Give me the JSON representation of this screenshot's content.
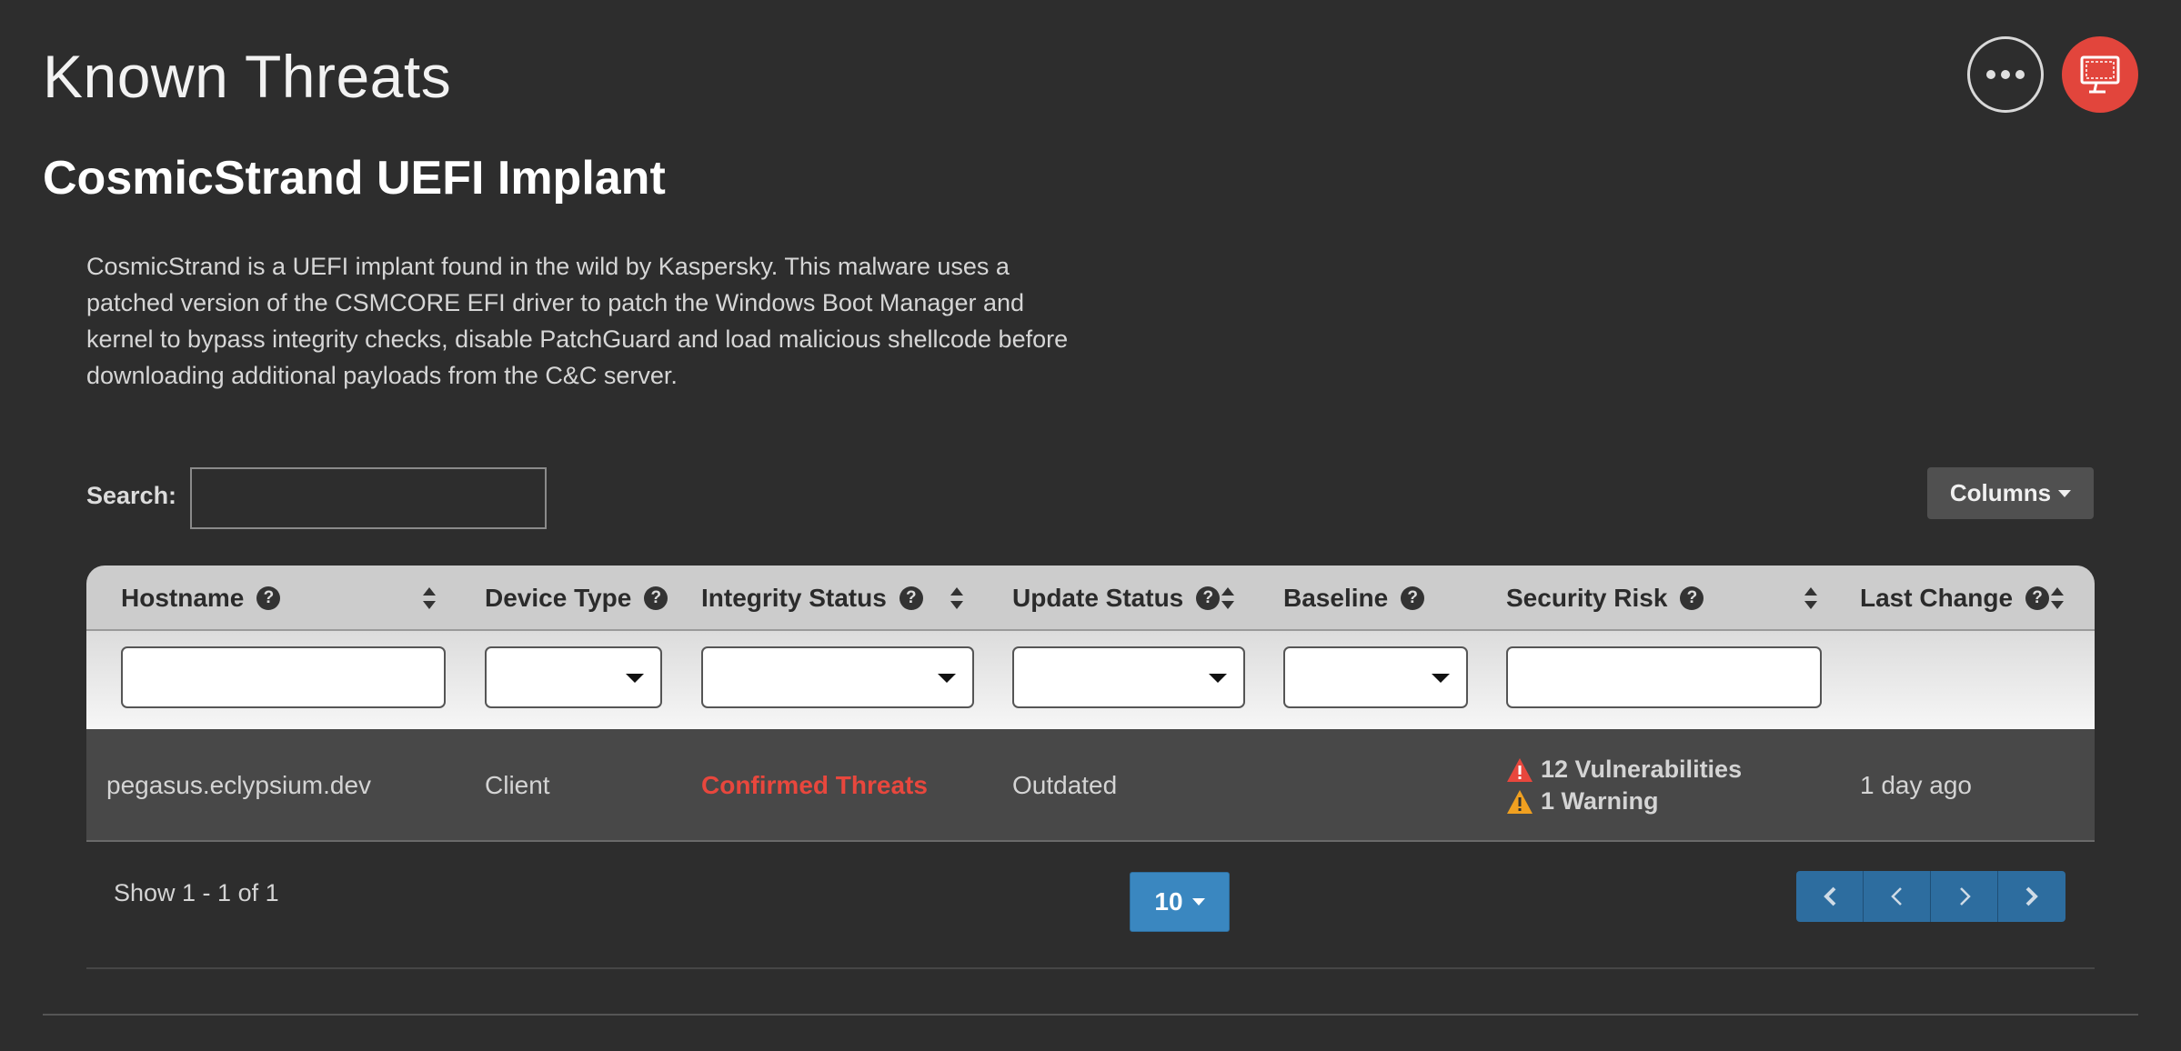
{
  "page": {
    "title": "Known Threats"
  },
  "actions": {
    "more_icon": "ellipsis-icon",
    "device_icon": "monitor-icon",
    "device_color": "#e2453c"
  },
  "threat": {
    "name": "CosmicStrand UEFI Implant",
    "description": "CosmicStrand is a UEFI implant found in the wild by Kaspersky. This malware uses a patched version of the CSMCORE EFI driver to patch the Windows Boot Manager and kernel to bypass integrity checks, disable PatchGuard and load malicious shellcode before downloading additional payloads from the C&C server."
  },
  "search": {
    "label": "Search:",
    "value": "",
    "placeholder": ""
  },
  "toolbar": {
    "columns_label": "Columns"
  },
  "table": {
    "columns": {
      "hostname": "Hostname",
      "device_type": "Device Type",
      "integrity_status": "Integrity Status",
      "update_status": "Update Status",
      "baseline": "Baseline",
      "security_risk": "Security Risk",
      "last_change": "Last Change"
    },
    "help_glyph": "?",
    "rows": [
      {
        "hostname": "pegasus.eclypsium.dev",
        "device_type": "Client",
        "integrity_status": "Confirmed Threats",
        "update_status": "Outdated",
        "baseline": "",
        "risk_vulnerabilities": "12 Vulnerabilities",
        "risk_warning": "1 Warning",
        "last_change": "1 day ago"
      }
    ]
  },
  "pagination": {
    "summary": "Show 1 - 1 of 1",
    "page_size": "10"
  },
  "colors": {
    "background": "#2d2d2d",
    "danger": "#e8473d",
    "warning": "#f0a020",
    "primary": "#3a87c0",
    "pager": "#2d6d9f"
  }
}
